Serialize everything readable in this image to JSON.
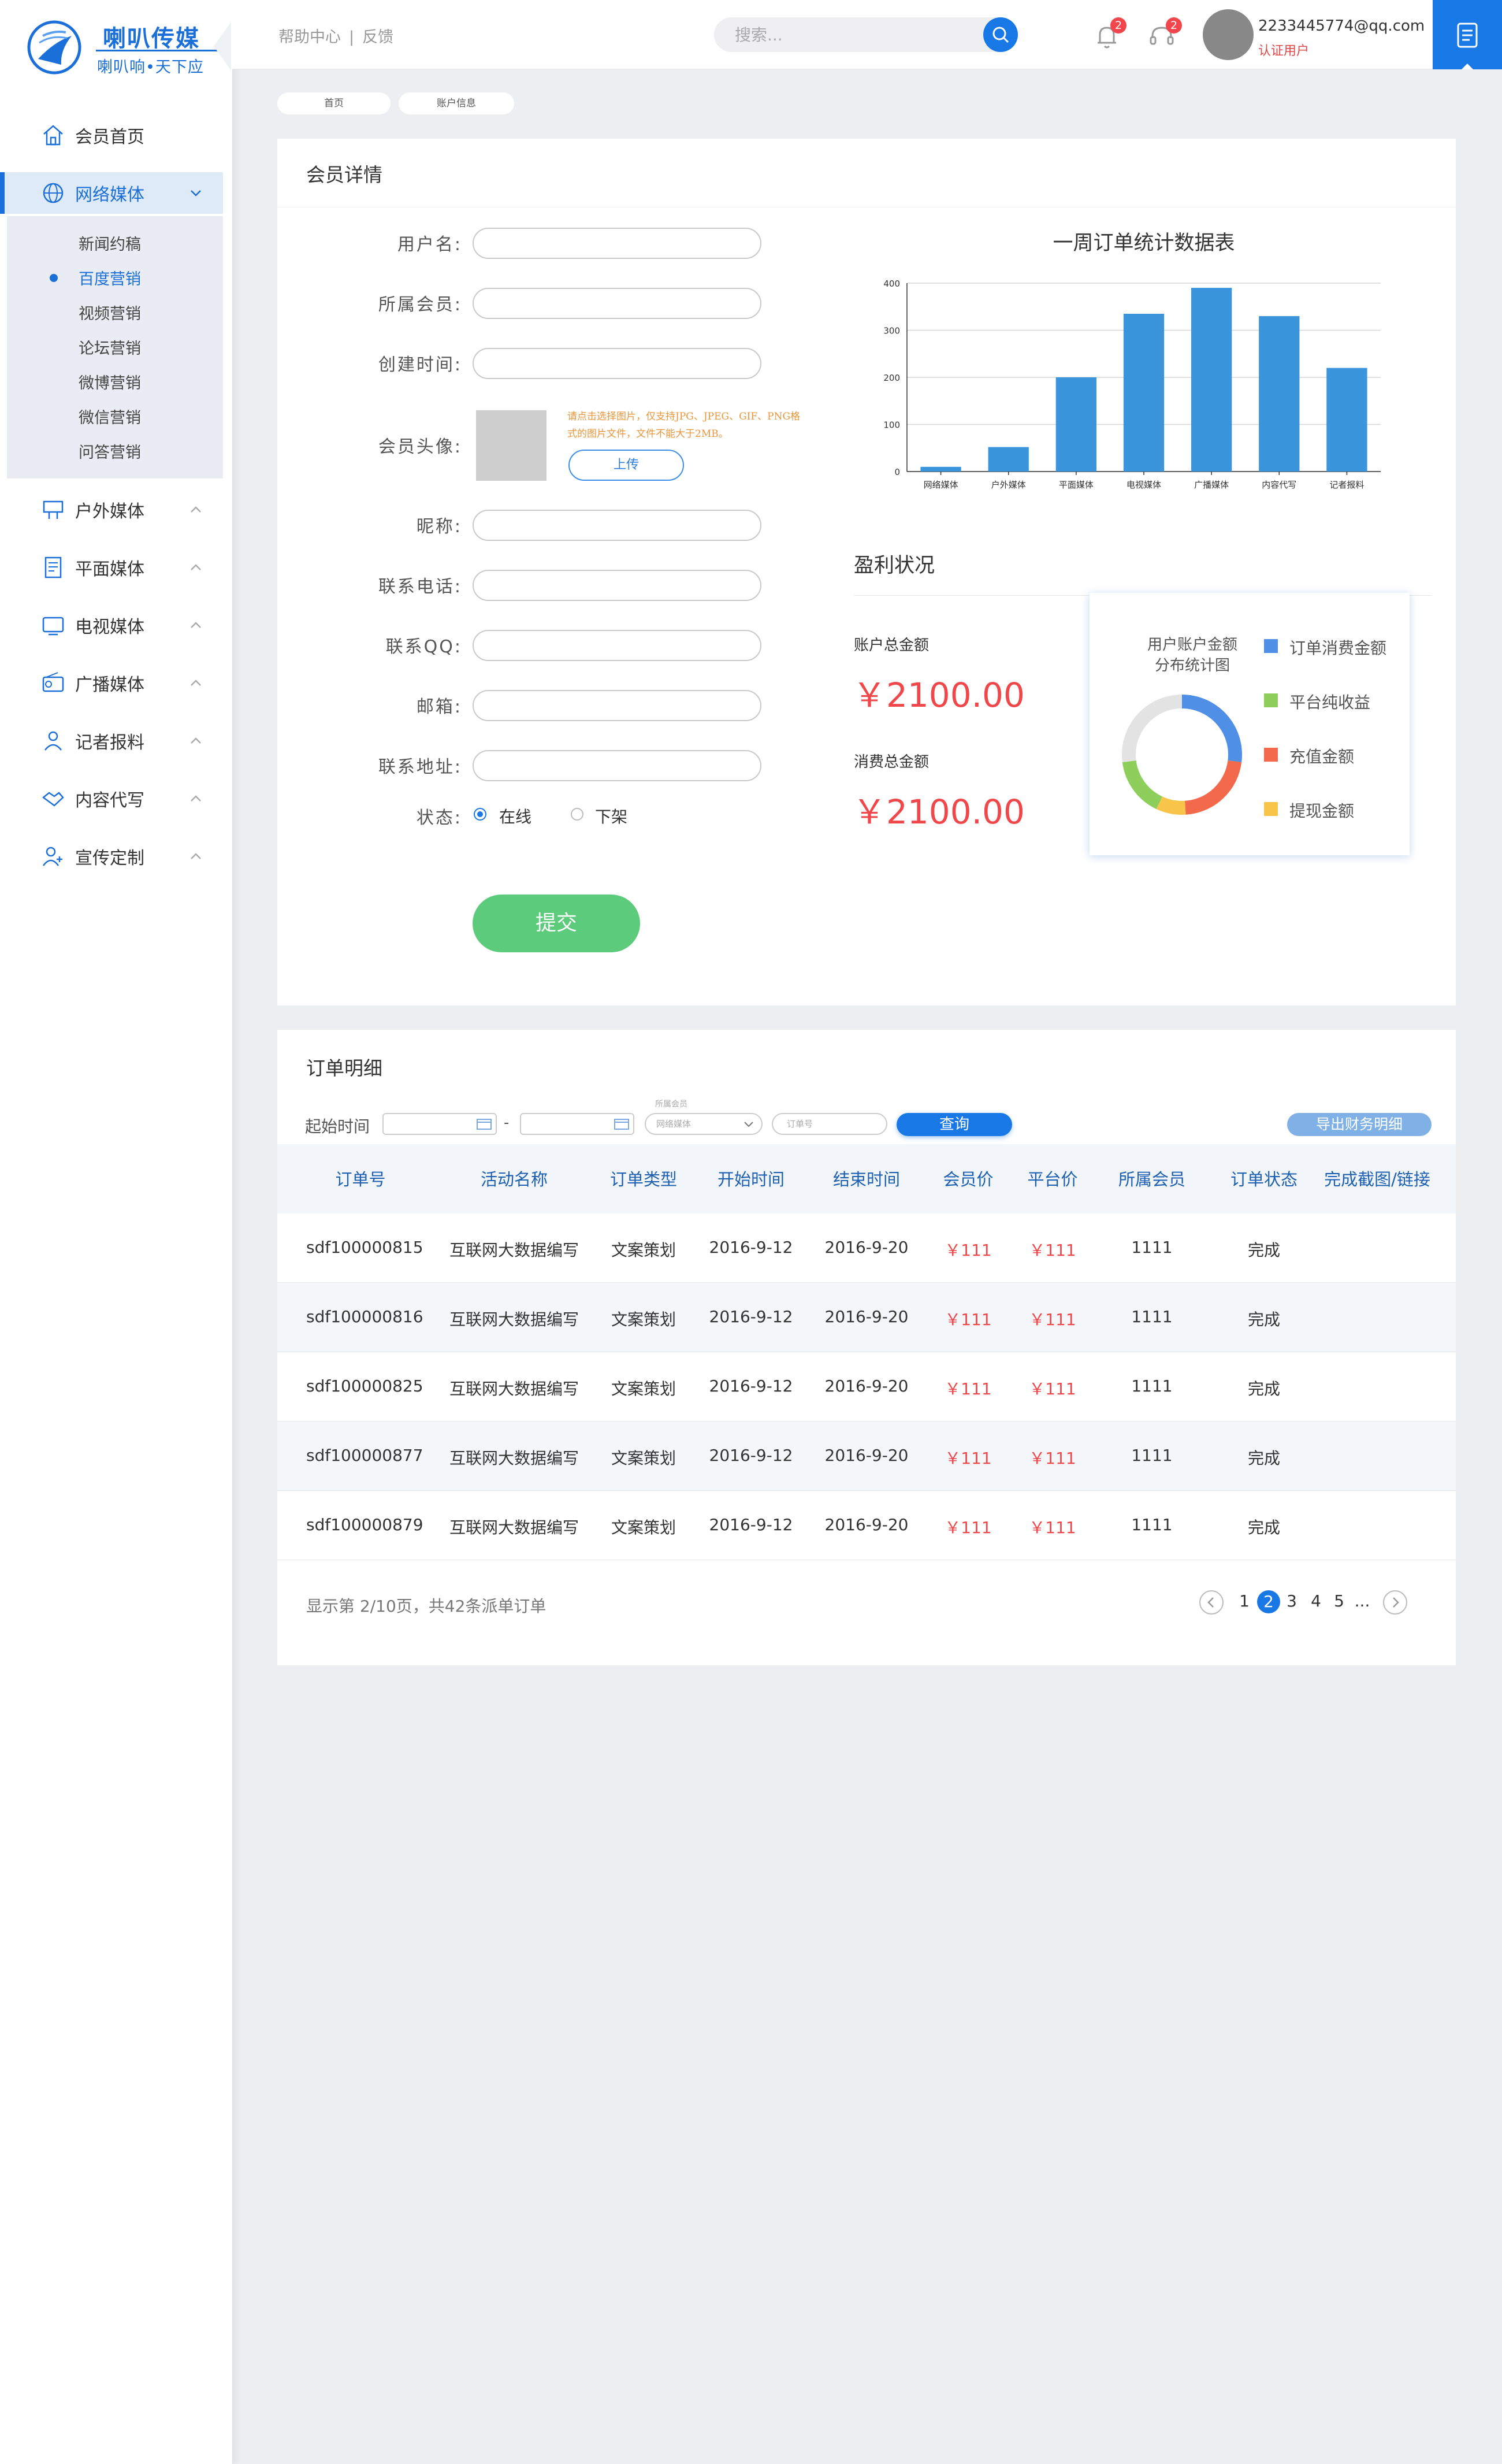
{
  "brand": {
    "title": "喇叭传媒",
    "subtitle": "喇叭响•天下应"
  },
  "header": {
    "links": [
      "帮助中心",
      "反馈"
    ],
    "separator": "|",
    "search_placeholder": "搜索...",
    "notification_count": "2",
    "service_count": "2",
    "user_email": "2233445774@qq.com",
    "user_role": "认证用户"
  },
  "sidebar": {
    "items": [
      {
        "label": "会员首页",
        "icon": "home-icon"
      },
      {
        "label": "网络媒体",
        "icon": "globe-icon",
        "expanded": true
      },
      {
        "label": "户外媒体",
        "icon": "billboard-icon"
      },
      {
        "label": "平面媒体",
        "icon": "print-icon"
      },
      {
        "label": "电视媒体",
        "icon": "tv-icon"
      },
      {
        "label": "广播媒体",
        "icon": "radio-icon"
      },
      {
        "label": "记者报料",
        "icon": "reporter-icon"
      },
      {
        "label": "内容代写",
        "icon": "handshake-icon"
      },
      {
        "label": "宣传定制",
        "icon": "person-icon"
      }
    ],
    "subitems": [
      "新闻约稿",
      "百度营销",
      "视频营销",
      "论坛营销",
      "微博营销",
      "微信营销",
      "问答营销"
    ],
    "active_subitem": "百度营销"
  },
  "breadcrumb": [
    "首页",
    "账户信息"
  ],
  "member": {
    "title": "会员详情",
    "fields": {
      "username": "用户名:",
      "member_of": "所属会员:",
      "created": "创建时间:",
      "avatar": "会员头像:",
      "nickname": "昵称:",
      "phone": "联系电话:",
      "qq": "联系QQ:",
      "email": "邮箱:",
      "address": "联系地址:",
      "status": "状态:"
    },
    "upload_hint": "请点击选择图片，仅支持JPG、JPEG、GIF、PNG格式的图片文件，文件不能大于2MB。",
    "upload_label": "上传",
    "status_online": "在线",
    "status_offline": "下架",
    "submit_label": "提交"
  },
  "chart_data": {
    "type": "bar",
    "title": "一周订单统计数据表",
    "categories": [
      "网络媒体",
      "户外媒体",
      "平面媒体",
      "电视媒体",
      "广播媒体",
      "内容代写",
      "记者报料"
    ],
    "values": [
      10,
      52,
      200,
      335,
      390,
      330,
      220
    ],
    "ylim": [
      0,
      400
    ],
    "yticks": [
      0,
      100,
      200,
      300,
      400
    ],
    "grid": true,
    "color": "#3a95dc"
  },
  "profit": {
    "title": "盈利状况",
    "total_label": "账户总金额",
    "total_value": "￥2100.00",
    "spent_label": "消费总金额",
    "spent_value": "￥2100.00",
    "donut_title_1": "用户账户金额",
    "donut_title_2": "分布统计图",
    "legend": [
      {
        "label": "订单消费金额",
        "color": "#4f8fe6"
      },
      {
        "label": "平台纯收益",
        "color": "#8ecf5c"
      },
      {
        "label": "充值金额",
        "color": "#f26a4b"
      },
      {
        "label": "提现金额",
        "color": "#f8c44a"
      }
    ],
    "donut_segments": [
      {
        "name": "订单消费金额",
        "share": 0.27,
        "color": "#4f8fe6"
      },
      {
        "name": "充值金额",
        "share": 0.22,
        "color": "#f26a4b"
      },
      {
        "name": "提现金额",
        "share": 0.08,
        "color": "#f8c44a"
      },
      {
        "name": "平台纯收益",
        "share": 0.16,
        "color": "#8ecf5c"
      },
      {
        "name": "remaining",
        "share": 0.27,
        "color": "#e3e3e3"
      }
    ]
  },
  "orders": {
    "title": "订单明细",
    "filter_label": "起始时间",
    "date_separator": "-",
    "select_caption": "所属会员",
    "select_value": "网络媒体",
    "order_placeholder": "订单号",
    "query_label": "查询",
    "export_label": "导出财务明细",
    "columns": [
      "订单号",
      "活动名称",
      "订单类型",
      "开始时间",
      "结束时间",
      "会员价",
      "平台价",
      "所属会员",
      "订单状态",
      "完成截图/链接"
    ],
    "rows": [
      [
        "sdf100000815",
        "互联网大数据编写",
        "文案策划",
        "2016-9-12",
        "2016-9-20",
        "￥111",
        "￥111",
        "1111",
        "完成",
        ""
      ],
      [
        "sdf100000816",
        "互联网大数据编写",
        "文案策划",
        "2016-9-12",
        "2016-9-20",
        "￥111",
        "￥111",
        "1111",
        "完成",
        ""
      ],
      [
        "sdf100000825",
        "互联网大数据编写",
        "文案策划",
        "2016-9-12",
        "2016-9-20",
        "￥111",
        "￥111",
        "1111",
        "完成",
        ""
      ],
      [
        "sdf100000877",
        "互联网大数据编写",
        "文案策划",
        "2016-9-12",
        "2016-9-20",
        "￥111",
        "￥111",
        "1111",
        "完成",
        ""
      ],
      [
        "sdf100000879",
        "互联网大数据编写",
        "文案策划",
        "2016-9-12",
        "2016-9-20",
        "￥111",
        "￥111",
        "1111",
        "完成",
        ""
      ]
    ],
    "pager_info": "显示第 2/10页，共42条派单订单",
    "pages": [
      "1",
      "2",
      "3",
      "4",
      "5",
      "..."
    ],
    "current_page": "2"
  }
}
